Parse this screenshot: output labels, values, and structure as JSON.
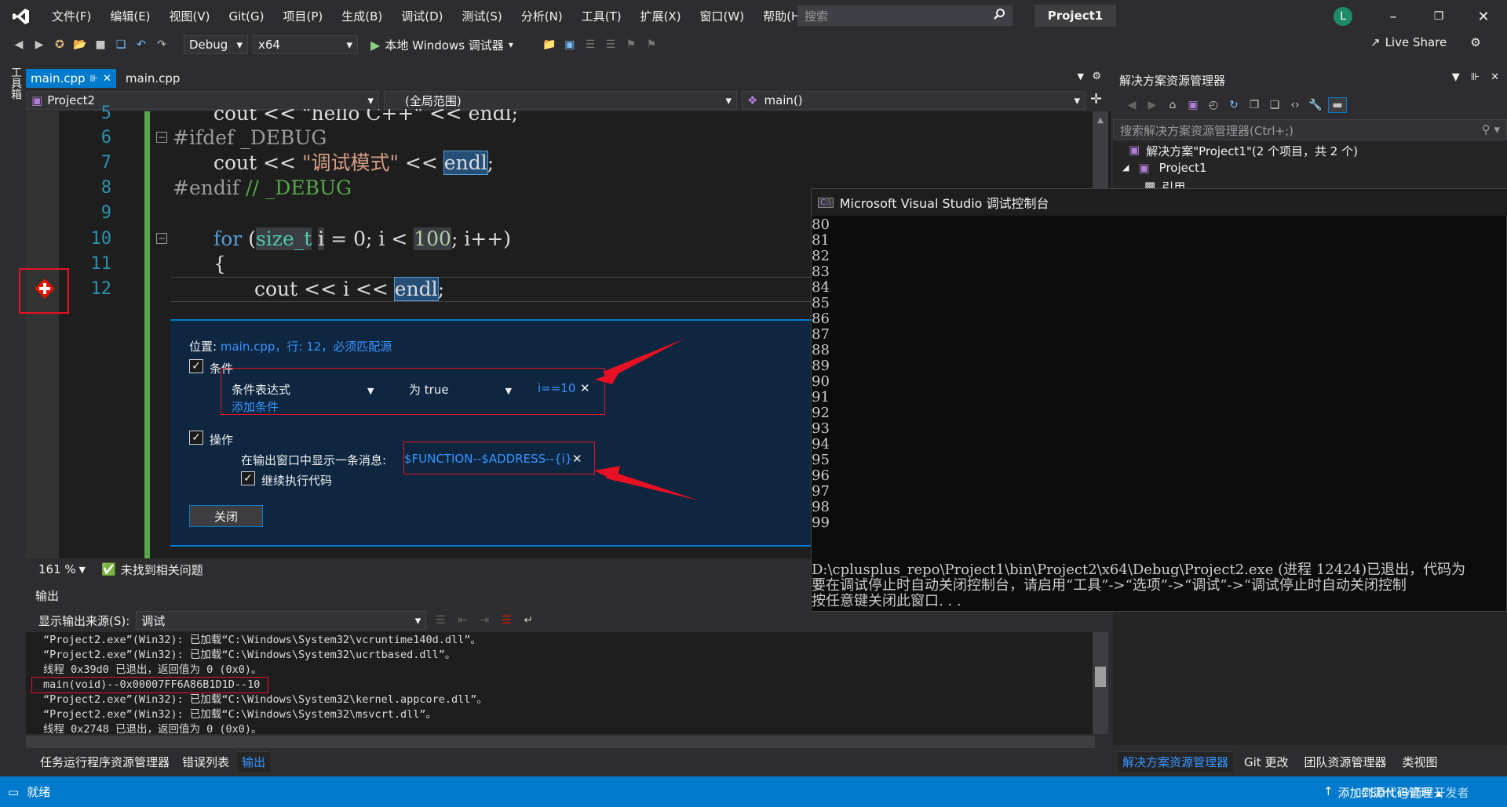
{
  "menu": [
    "文件(F)",
    "编辑(E)",
    "视图(V)",
    "Git(G)",
    "项目(P)",
    "生成(B)",
    "调试(D)",
    "测试(S)",
    "分析(N)",
    "工具(T)",
    "扩展(X)",
    "窗口(W)",
    "帮助(H)"
  ],
  "search_placeholder": "搜索",
  "project_name": "Project1",
  "avatar_letter": "L",
  "toolbar": {
    "config": "Debug",
    "platform": "x64",
    "run_label": "本地 Windows 调试器",
    "live_share": "Live Share"
  },
  "toolbox_label": "工具箱",
  "tabs": [
    {
      "label": "main.cpp",
      "active": true
    },
    {
      "label": "main.cpp",
      "active": false
    }
  ],
  "nav": {
    "project": "Project2",
    "scope": "(全局范围)",
    "member": "main()"
  },
  "code": {
    "lines": [
      "5",
      "6",
      "7",
      "8",
      "9",
      "10",
      "11",
      "12"
    ],
    "l5": "cout << \"hello C++\" << endl;",
    "l6_kw": "#ifdef",
    "l6_rest": " _DEBUG",
    "l7_a": "cout << ",
    "l7_str": "\"调试模式\"",
    "l7_b": " << ",
    "l7_endl": "endl",
    "l7_c": ";",
    "l8_kw": "#endif",
    "l8_cm": " // _DEBUG",
    "l10_for": "for",
    "l10_a": " (",
    "l10_type": "size_t",
    "l10_b": " ",
    "l10_i": "i",
    "l10_c": " = 0; i < ",
    "l10_num": "100",
    "l10_d": "; i++)",
    "l11": "{",
    "l12_a": "cout << i << ",
    "l12_endl": "endl",
    "l12_c": ";"
  },
  "bp": {
    "location_label": "位置:",
    "location_value": "main.cpp，行: 12，必须匹配源",
    "conditions_label": "条件",
    "cond_type": "条件表达式",
    "cond_op": "为 true",
    "cond_value": "i==10",
    "add_condition": "添加条件",
    "actions_label": "操作",
    "message_label": "在输出窗口中显示一条消息:",
    "message_value": "$FUNCTION--$ADDRESS--{i}",
    "continue_label": "继续执行代码",
    "close_label": "关闭"
  },
  "editor_status": {
    "zoom": "161 %",
    "issues": "未找到相关问题"
  },
  "output": {
    "title": "输出",
    "source_label": "显示输出来源(S):",
    "source_value": "调试",
    "lines": [
      "“Project2.exe”(Win32): 已加载“C:\\Windows\\System32\\vcruntime140d.dll”。",
      "“Project2.exe”(Win32): 已加载“C:\\Windows\\System32\\ucrtbased.dll”。",
      "线程 0x39d0 已退出，返回值为 0 (0x0)。",
      "main(void)--0x00007FF6A86B1D1D--10",
      "“Project2.exe”(Win32): 已加载“C:\\Windows\\System32\\kernel.appcore.dll”。",
      "“Project2.exe”(Win32): 已加载“C:\\Windows\\System32\\msvcrt.dll”。",
      "线程 0x2748 已退出，返回值为 0 (0x0)。"
    ],
    "tabs": [
      "任务运行程序资源管理器",
      "错误列表",
      "输出"
    ]
  },
  "solution": {
    "title": "解决方案资源管理器",
    "search_placeholder": "搜索解决方案资源管理器(Ctrl+;)",
    "root": "解决方案\"Project1\"(2 个项目，共 2 个)",
    "project": "Project1",
    "child": "引用",
    "tabs": [
      "解决方案资源管理器",
      "Git 更改",
      "团队资源管理器",
      "类视图"
    ]
  },
  "console": {
    "title": "Microsoft Visual Studio 调试控制台",
    "numbers": [
      "80",
      "81",
      "82",
      "83",
      "84",
      "85",
      "86",
      "87",
      "88",
      "89",
      "90",
      "91",
      "92",
      "93",
      "94",
      "95",
      "96",
      "97",
      "98",
      "99"
    ],
    "exit_line1": "D:\\cplusplus_repo\\Project1\\bin\\Project2\\x64\\Debug\\Project2.exe (进程 12424)已退出，代码为",
    "exit_line2": "要在调试停止时自动关闭控制台，请启用“工具”->“选项”->“调试”->“调试停止时自动关闭控制",
    "exit_line3": "按任意键关闭此窗口. . ."
  },
  "statusbar": {
    "ready": "就绪",
    "source_control": "添加到源代码管理 ▴",
    "watermark": "CSDN @通程开发者"
  }
}
